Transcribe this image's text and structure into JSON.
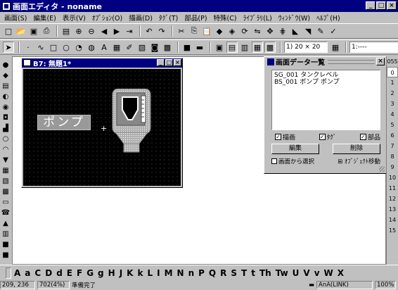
{
  "app": {
    "title": "画面エディタ - noname"
  },
  "menu": [
    "画面(S)",
    "編集(E)",
    "表示(V)",
    "ｵﾌﾟｼｮﾝ(O)",
    "描画(D)",
    "ﾀｸﾞ(T)",
    "部品(P)",
    "特殊(C)",
    "ﾗｲﾌﾞﾗﾘ(L)",
    "ｳｨﾝﾄﾞｳ(W)",
    "ﾍﾙﾌﾟ(H)"
  ],
  "toolbar1": {
    "icons": [
      "new-icon",
      "open-icon",
      "save-icon",
      "print-icon",
      "screen-list-icon",
      "zoom-in-icon",
      "zoom-out-icon",
      "prev-screen-icon",
      "next-screen-icon",
      "jump-icon",
      "undo-icon",
      "redo-icon",
      "cut-icon",
      "copy-icon",
      "paste-icon",
      "group-icon",
      "ungroup-icon",
      "rotate-icon",
      "flip-icon",
      "align-icon",
      "grid-icon",
      "bring-front-icon",
      "send-back-icon",
      "dropper-icon",
      "check-icon"
    ]
  },
  "toolbar2": {
    "zoom_value": "1) 20 × 20",
    "layer_value": "1:----"
  },
  "child_window": {
    "title": "B7: 無題1*",
    "pump_text": "ポンプ",
    "plus": "+"
  },
  "data_panel": {
    "title": "画面データ一覧",
    "items": [
      "SG_001  タンクレベル",
      "BS_001  ポンプ  ポンプ"
    ],
    "checks": [
      {
        "label": "描画",
        "checked": true
      },
      {
        "label": "ﾀｸﾞ",
        "checked": true
      },
      {
        "label": "部品",
        "checked": true
      }
    ],
    "edit_button": "編集",
    "delete_button": "削除",
    "select_from_screen": "画面から選択",
    "object_move": "ｵﾌﾞｼﾞｪｸﾄ移動"
  },
  "right_numbers": [
    "055",
    "0",
    "1",
    "2",
    "3",
    "4",
    "5",
    "6",
    "7",
    "8",
    "9",
    "10",
    "11",
    "12",
    "13",
    "14",
    "15"
  ],
  "charbar": [
    "A",
    "a",
    "C",
    "D",
    "d",
    "E",
    "F",
    "G",
    "g",
    "H",
    "J",
    "K",
    "k",
    "L",
    "I",
    "M",
    "N",
    "n",
    "P",
    "Q",
    "R",
    "S",
    "T",
    "t",
    "Th",
    "Tw",
    "U",
    "V",
    "v",
    "W",
    "X"
  ],
  "status": {
    "coords": "209, 236",
    "zoom": "702(4%)",
    "message": "準備完了",
    "connection": "AnA(LINK)",
    "percent": "100%"
  }
}
